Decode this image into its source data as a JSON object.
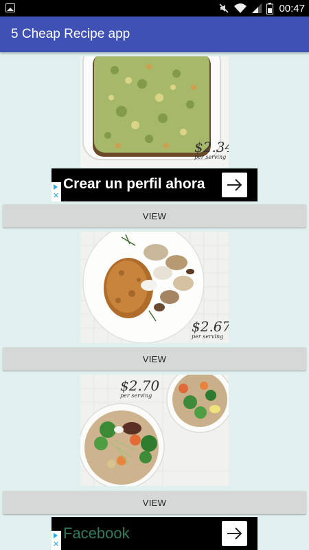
{
  "status_bar": {
    "time": "00:47"
  },
  "app_bar": {
    "title": "5 Cheap Recipe app"
  },
  "recipes": [
    {
      "price": "$2.34",
      "per_serving": "per serving",
      "view_label": "VIEW"
    },
    {
      "price": "$2.67",
      "per_serving": "per serving",
      "view_label": "VIEW"
    },
    {
      "price": "$2.70",
      "per_serving": "per serving",
      "view_label": "VIEW"
    }
  ],
  "ads": [
    {
      "text": "Crear un perfil ahora"
    },
    {
      "text": "Facebook"
    }
  ],
  "colors": {
    "app_bar": "#3f51b5",
    "background": "#e0f0ee",
    "button": "#d6d7d7"
  }
}
